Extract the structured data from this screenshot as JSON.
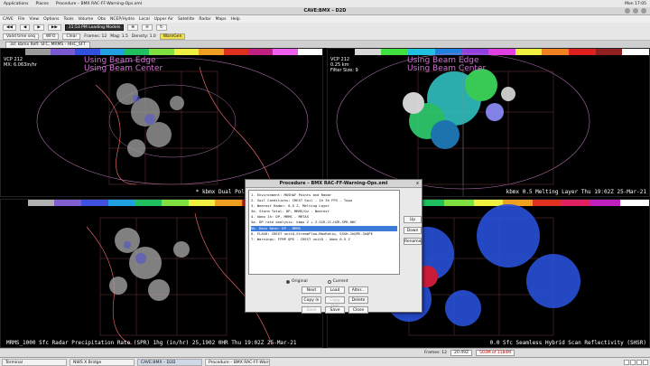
{
  "system": {
    "applications": "Applications",
    "places": "Places",
    "window_menu": "Procedure – BMX RAC-FF-Warning-Ops.xml",
    "clock": "Mon 17:05"
  },
  "window": {
    "title": "CAVE:BMX – D2D"
  },
  "menubar": [
    "CAVE",
    "File",
    "View",
    "Options",
    "Tools",
    "Volume",
    "Obs",
    "NCEP/Hydro",
    "Local",
    "Upper Air",
    "Satellite",
    "Radar",
    "Maps",
    "Help"
  ],
  "toolbar": {
    "status": "11:53 PM Loading Models",
    "valid_time": "Valid time seq",
    "wfo": "WFO",
    "clear": "Clear",
    "frames_label": "Frames: 12",
    "mag_label": "Mag: 1.5",
    "density_label": "Density: 1.0",
    "warngen": "WarnGen",
    "panes": "Panes",
    "localization": "Localization"
  },
  "tab": {
    "label": "3d: kbmx Refl: SFC, MRMS - HHC_SFT"
  },
  "panes": [
    {
      "info": [
        "VCP 212",
        "MX: 6.063in/hr"
      ],
      "beam": [
        "Using Beam Edge",
        "Using Beam Center"
      ],
      "caption": "* kbmx Dual Pol Inst Precip Rate (in/h"
    },
    {
      "info": [
        "VCP 212",
        "0.25 km",
        "Filter Size: 9"
      ],
      "beam": [
        "Using Beam Edge",
        "Using Beam Center"
      ],
      "caption": "kbmx 0.5 Melting Layer  Thu 19:02Z 25-Mar-21"
    },
    {
      "info": [],
      "beam": [],
      "caption": "MRMS_1000 Sfc Radar Precipitation Rate (SPR) 1hg (in/hr)  25,1902  0HR Thu 19:02Z 25-Mar-21"
    },
    {
      "info": [],
      "beam": [],
      "caption": "0.0 Sfc Seamless Hybrid Scan Reflectivity (SHSR)"
    }
  ],
  "dialog": {
    "title": "Procedure – BMX RAC-FF-Warning-Ops.xml",
    "close": "x",
    "items": [
      "1. Environment: MUSHAF Points and Radar",
      "2. Soil Conditions: CREST Soil - 1h 3h FPS - Topo",
      "3. Nearest Radar: 0.5 Z, Melting Layer",
      "3a. Storm Total: DP, MRMS/Oz - Nearest",
      "4. kbmx 1h: DP, MRMS - MRTAS",
      "5a. DP rate analysis: kbmx Z + Z-SIR-CC-HZR-SPR-HHC",
      "5b. Rain Rate: DP - MRMS",
      "6. FLASH: CREST unitQ-StreamFlow-MaxRatio, SSSH-1hQPE-3hQPE",
      "7. Warnings: FFMP QPE - CREST unitQ - kbmx 0.5 Z"
    ],
    "selected_index": 6,
    "side_buttons": [
      "Up",
      "Down",
      "Rename..."
    ],
    "radio_original": "Original",
    "radio_current": "Current",
    "buttons": [
      {
        "label": "Next",
        "enabled": true
      },
      {
        "label": "Load",
        "enabled": true
      },
      {
        "label": "Alter...",
        "enabled": true
      },
      {
        "label": "Copy In",
        "enabled": true
      },
      {
        "label": "Copy Out",
        "enabled": false
      },
      {
        "label": "Delete",
        "enabled": true
      },
      {
        "label": "Save",
        "enabled": false
      },
      {
        "label": "Save As...",
        "enabled": true
      },
      {
        "label": "Close",
        "enabled": true
      }
    ]
  },
  "statusbar": {
    "frames": "Frames: 12",
    "time": "20:49Z",
    "memory": "503M of 1184M"
  },
  "taskbar": [
    {
      "label": "Terminal",
      "active": false
    },
    {
      "label": "NWS X Bridge",
      "active": false
    },
    {
      "label": "CAVE:BMX – D2D",
      "active": true
    },
    {
      "label": "Procedure – BMX RAC-FF-Warning...",
      "active": false
    }
  ],
  "colors": {
    "beam_text": "#d070d0",
    "selection": "#3d7bd9"
  }
}
